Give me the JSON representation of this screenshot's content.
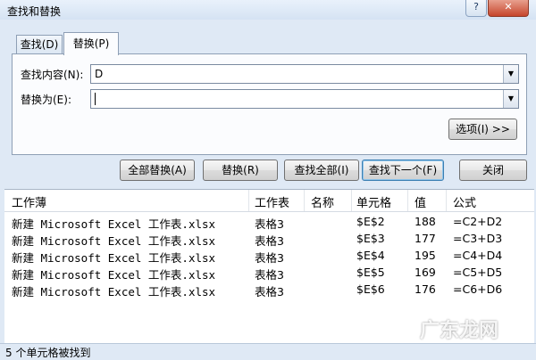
{
  "window": {
    "title": "查找和替换",
    "help_label": "?",
    "close_label": "✕"
  },
  "tabs": [
    {
      "label": "查找(D)",
      "active": false
    },
    {
      "label": "替换(P)",
      "active": true
    }
  ],
  "form": {
    "find_label": "查找内容(N):",
    "find_value": "D",
    "replace_label": "替换为(E):",
    "replace_value": ""
  },
  "buttons": {
    "options": "选项(I) >>",
    "replace_all": "全部替换(A)",
    "replace": "替换(R)",
    "find_all": "查找全部(I)",
    "find_next": "查找下一个(F)",
    "close": "关闭"
  },
  "results": {
    "columns": [
      "工作薄",
      "工作表",
      "名称",
      "单元格",
      "值",
      "公式"
    ],
    "rows": [
      {
        "workbook": "新建 Microsoft Excel 工作表.xlsx",
        "sheet": "表格3",
        "name": "",
        "cell": "$E$2",
        "value": "188",
        "formula": "=C2+D2"
      },
      {
        "workbook": "新建 Microsoft Excel 工作表.xlsx",
        "sheet": "表格3",
        "name": "",
        "cell": "$E$3",
        "value": "177",
        "formula": "=C3+D3"
      },
      {
        "workbook": "新建 Microsoft Excel 工作表.xlsx",
        "sheet": "表格3",
        "name": "",
        "cell": "$E$4",
        "value": "195",
        "formula": "=C4+D4"
      },
      {
        "workbook": "新建 Microsoft Excel 工作表.xlsx",
        "sheet": "表格3",
        "name": "",
        "cell": "$E$5",
        "value": "169",
        "formula": "=C5+D5"
      },
      {
        "workbook": "新建 Microsoft Excel 工作表.xlsx",
        "sheet": "表格3",
        "name": "",
        "cell": "$E$6",
        "value": "176",
        "formula": "=C6+D6"
      }
    ]
  },
  "status": {
    "text": "5 个单元格被找到"
  },
  "watermark": {
    "text": "广东龙网"
  }
}
